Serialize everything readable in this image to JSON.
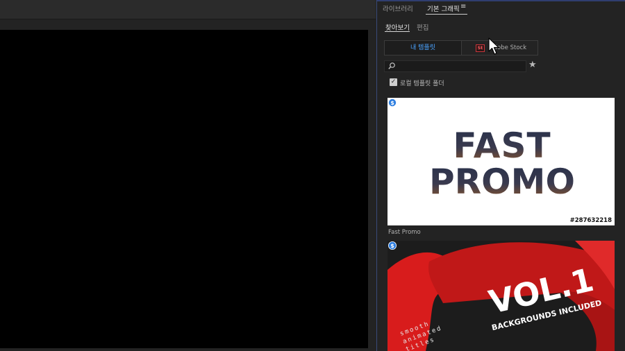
{
  "panel": {
    "tabs": [
      {
        "label": "라이브러리"
      },
      {
        "label": "기본 그래픽"
      }
    ],
    "menu_icon": "≡",
    "subtabs": [
      {
        "label": "찾아보기"
      },
      {
        "label": "편집"
      }
    ]
  },
  "sources": {
    "my_templates": "내 템플릿",
    "stock_logo": "St",
    "adobe_stock": "Adobe Stock"
  },
  "search": {
    "placeholder": "",
    "value": ""
  },
  "local_folder": {
    "checked": true,
    "label": "로컬 템플릿 폴더"
  },
  "templates": [
    {
      "line1": "FAST",
      "line2": "PROMO",
      "stock_id": "#287632218",
      "name": "Fast Promo"
    },
    {
      "title": "VOL.1",
      "subtitle": "BACKGROUNDS INCLUDED",
      "side_text_1": "smooth",
      "side_text_2": "animated",
      "side_text_3": "titles"
    }
  ],
  "icons": {
    "search": "search-icon",
    "favorites": "star-icon",
    "badge": "dollar-icon",
    "stock_logo": "adobe-stock-icon",
    "cursor": "mouse-cursor-icon"
  },
  "colors": {
    "panel_bg": "#232323",
    "accent_blue": "#4aa3ff",
    "badge_blue": "#2f7fe0",
    "promo_red": "#e02020",
    "stock_red": "#c9343a"
  }
}
